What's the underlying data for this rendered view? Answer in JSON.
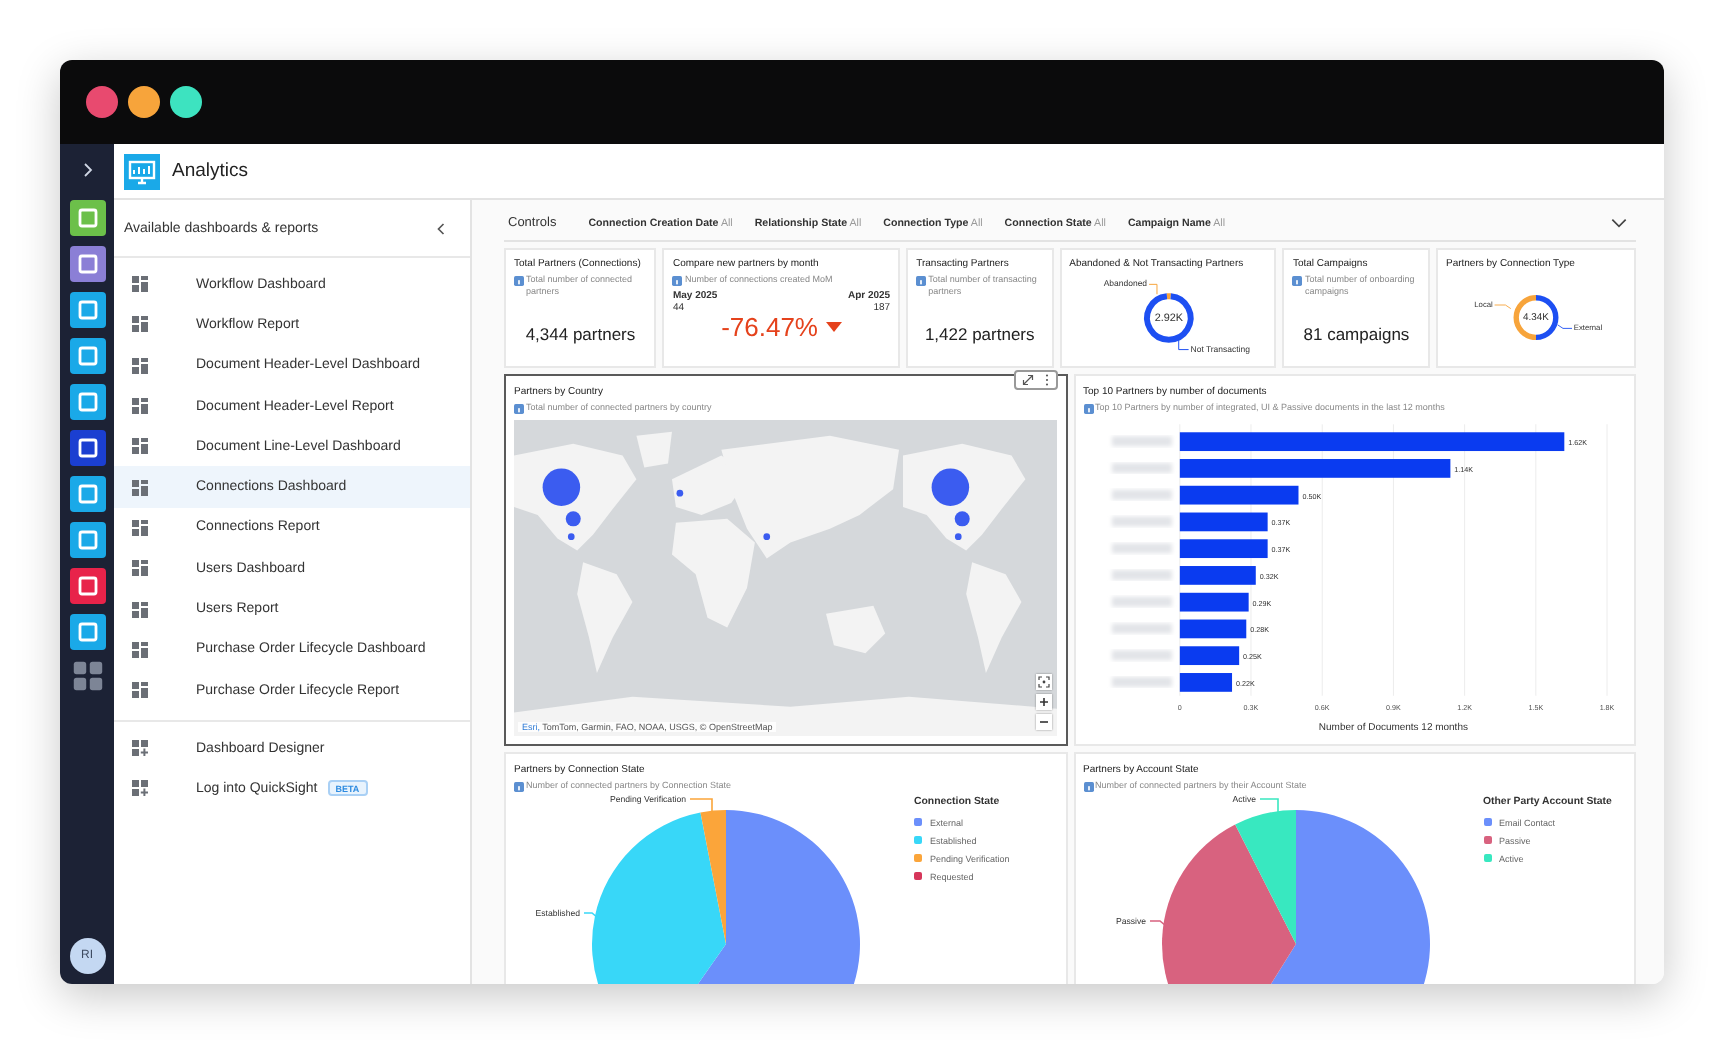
{
  "window": {
    "dots": [
      {
        "color": "#e84a6f"
      },
      {
        "color": "#f7a43b"
      },
      {
        "color": "#3de3c0"
      }
    ]
  },
  "rail": {
    "items": [
      {
        "color": "#6cc04a"
      },
      {
        "color": "#8b7fd6"
      },
      {
        "color": "#1aa9e8"
      },
      {
        "color": "#1aa9e8"
      },
      {
        "color": "#1aa9e8"
      },
      {
        "color": "#1b3fd1"
      },
      {
        "color": "#1aa9e8"
      },
      {
        "color": "#1aa9e8"
      },
      {
        "color": "#e8234a"
      },
      {
        "color": "#1aa9e8"
      }
    ],
    "avatar": "RI"
  },
  "header": {
    "title": "Analytics"
  },
  "sidebar": {
    "title": "Available dashboards & reports",
    "items": [
      {
        "label": "Workflow Dashboard",
        "selected": false
      },
      {
        "label": "Workflow Report",
        "selected": false
      },
      {
        "label": "Document Header-Level Dashboard",
        "selected": false
      },
      {
        "label": "Document Header-Level Report",
        "selected": false
      },
      {
        "label": "Document Line-Level Dashboard",
        "selected": false
      },
      {
        "label": "Connections Dashboard",
        "selected": true
      },
      {
        "label": "Connections Report",
        "selected": false
      },
      {
        "label": "Users Dashboard",
        "selected": false
      },
      {
        "label": "Users Report",
        "selected": false
      },
      {
        "label": "Purchase Order Lifecycle Dashboard",
        "selected": false
      },
      {
        "label": "Purchase Order Lifecycle Report",
        "selected": false
      }
    ],
    "tools": [
      {
        "label": "Dashboard Designer"
      },
      {
        "label": "Log into QuickSight",
        "badge": "BETA"
      }
    ]
  },
  "controls": {
    "label": "Controls",
    "filters": [
      {
        "name": "Connection Creation Date",
        "value": "All"
      },
      {
        "name": "Relationship State",
        "value": "All"
      },
      {
        "name": "Connection Type",
        "value": "All"
      },
      {
        "name": "Connection State",
        "value": "All"
      },
      {
        "name": "Campaign Name",
        "value": "All"
      }
    ]
  },
  "kpis": [
    {
      "kind": "number",
      "title": "Total Partners (Connections)",
      "info": "Total number of connected partners",
      "value": "4,344 partners"
    },
    {
      "kind": "compare",
      "title": "Compare new partners by month",
      "info": "Number of connections created MoM",
      "left_period": "May 2025",
      "left_value": "44",
      "right_period": "Apr 2025",
      "right_value": "187",
      "change": "-76.47%"
    },
    {
      "kind": "number",
      "title": "Transacting Partners",
      "info": "Total number of transacting partners",
      "value": "1,422 partners"
    },
    {
      "kind": "donut",
      "title": "Abandoned & Not Transacting Partners",
      "center": "2.92K",
      "segments": [
        {
          "label": "Abandoned",
          "color": "#f7a43b"
        },
        {
          "label": "Not Transacting",
          "color": "#1d4ff2"
        }
      ]
    },
    {
      "kind": "number",
      "title": "Total Campaigns",
      "info": "Total number of onboarding campaigns",
      "value": "81 campaigns"
    },
    {
      "kind": "donut",
      "title": "Partners by Connection Type",
      "center": "4.34K",
      "segments": [
        {
          "label": "Local",
          "color": "#f7a43b"
        },
        {
          "label": "External",
          "color": "#1d4ff2"
        }
      ]
    }
  ],
  "map_card": {
    "title": "Partners by Country",
    "info": "Total number of connected partners by country",
    "selected": true,
    "attribution_source": "Esri,",
    "attribution": "TomTom, Garmin, FAO, NOAA, USGS, © OpenStreetMap"
  },
  "bar_card": {
    "title": "Top 10 Partners by number of documents",
    "info": "Top 10 Partners by number of integrated, UI & Passive documents in the last 12 months",
    "chart_data": {
      "type": "bar",
      "orientation": "horizontal",
      "xlabel": "Number of Documents 12 months",
      "grid": true,
      "series": [
        {
          "color": "#0a3bf0",
          "values": [
            1620,
            1140,
            500,
            370,
            370,
            320,
            290,
            280,
            250,
            220
          ]
        }
      ],
      "xlim": [
        0,
        1800
      ],
      "xticks": [
        {
          "value": 0,
          "label": "0"
        },
        {
          "value": 300,
          "label": "0.3K"
        },
        {
          "value": 600,
          "label": "0.6K"
        },
        {
          "value": 900,
          "label": "0.9K"
        },
        {
          "value": 1200,
          "label": "1.2K"
        },
        {
          "value": 1500,
          "label": "1.5K"
        },
        {
          "value": 1800,
          "label": "1.8K"
        }
      ],
      "value_labels": [
        "1.62K",
        "1.14K",
        "0.50K",
        "0.37K",
        "0.37K",
        "0.32K",
        "0.29K",
        "0.28K",
        "0.25K",
        "0.22K"
      ]
    }
  },
  "pie_cards": [
    {
      "title": "Partners by Connection State",
      "info": "Number of connected partners by Connection State",
      "legend_title": "Connection State",
      "legend": [
        {
          "label": "External",
          "color": "#6b8ffb"
        },
        {
          "label": "Established",
          "color": "#38d7f8"
        },
        {
          "label": "Pending Verification",
          "color": "#fba53a"
        },
        {
          "label": "Requested",
          "color": "#d6365a"
        }
      ],
      "slice_labels": [
        "Established",
        "Pending Verification"
      ]
    },
    {
      "title": "Partners by Account State",
      "info": "Number of connected partners by their Account State",
      "legend_title": "Other Party Account State",
      "legend": [
        {
          "label": "Email Contact",
          "color": "#6b8ffb"
        },
        {
          "label": "Passive",
          "color": "#d8627f"
        },
        {
          "label": "Active",
          "color": "#38e8c0"
        }
      ],
      "slice_labels": [
        "Passive",
        "Active"
      ]
    }
  ]
}
